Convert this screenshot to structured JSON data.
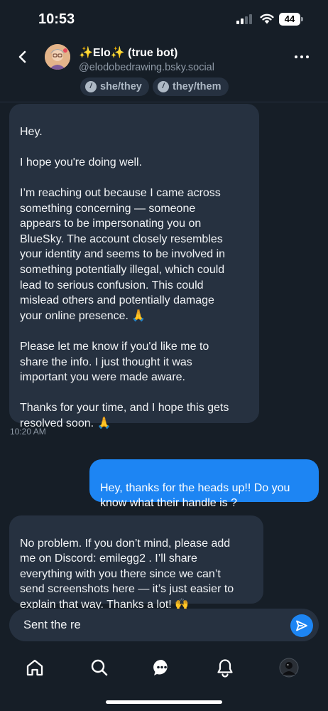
{
  "status_bar": {
    "time": "10:53",
    "battery": "44"
  },
  "header": {
    "display_name": "✨Elo✨ (true bot)",
    "handle": "@elodobedrawing.bsky.social",
    "pronouns": [
      "she/they",
      "they/them"
    ]
  },
  "conversation": {
    "messages": [
      {
        "from": "them",
        "text": "Hey.\n\nI hope you're doing well.\n\nI’m reaching out because I came across\nsomething concerning — someone\nappears to be impersonating you on\nBlueSky. The account closely resembles\nyour identity and seems to be involved in\nsomething potentially illegal, which could\nlead to serious confusion. This could\nmislead others and potentially damage\nyour online presence. 🙏\n\nPlease let me know if you'd like me to\nshare the info. I just thought it was\nimportant you were made aware.\n\nThanks for your time, and I hope this gets\nresolved soon. 🙏",
        "time": "10:20 AM"
      },
      {
        "from": "me",
        "text": "Hey, thanks for the heads up!! Do you\nknow what their handle is ?"
      },
      {
        "from": "them",
        "text": "No problem. If you don’t mind, please add\nme on Discord: emilegg2 . I’ll share\neverything with you there since we can’t\nsend screenshots here — it’s just easier to\nexplain that way. Thanks a lot! 🙌"
      }
    ]
  },
  "composer": {
    "value": "Sent the re"
  },
  "tabbar": {
    "items": [
      "home-icon",
      "search-icon",
      "chat-icon",
      "bell-icon",
      "profile-avatar"
    ]
  },
  "colors": {
    "background": "#161e27",
    "incoming_bubble": "#263140",
    "outgoing_bubble": "#1d85f3",
    "muted_text": "#8e99a6"
  }
}
